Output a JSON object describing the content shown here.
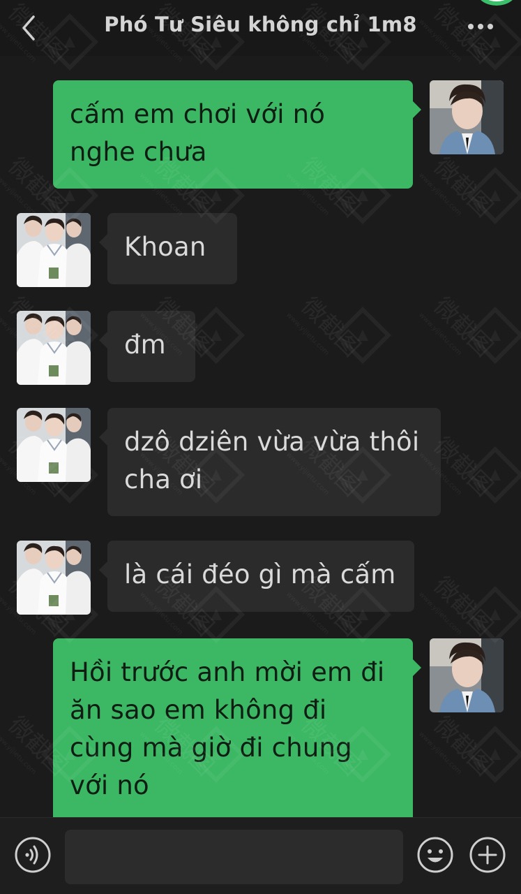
{
  "header": {
    "title": "Phó Tư Siêu không chỉ 1m8",
    "back_icon": "chevron-left-icon",
    "more_icon": "more-dots-icon"
  },
  "messages": [
    {
      "side": "out",
      "text": "cấm em chơi với nó nghe chưa"
    },
    {
      "side": "in",
      "text": "Khoan"
    },
    {
      "side": "in",
      "text": "đm"
    },
    {
      "side": "in",
      "text": "dzô dziên vừa vừa thôi cha ơi"
    },
    {
      "side": "in",
      "text": "là cái đéo gì mà cấm"
    },
    {
      "side": "out",
      "text": "Hồi trước anh mời em đi ăn sao em không đi cùng mà giờ đi chung với nó"
    }
  ],
  "input_bar": {
    "voice_icon": "voice-icon",
    "emoji_icon": "emoji-icon",
    "plus_icon": "plus-icon",
    "message_value": ""
  },
  "watermark": {
    "text": "微截图",
    "url": "www.yijietu.com"
  },
  "colors": {
    "background": "#1b1b1b",
    "outgoing_bubble": "#3cb864",
    "incoming_bubble": "#2b2b2b",
    "header_text": "#d4d4d4"
  }
}
